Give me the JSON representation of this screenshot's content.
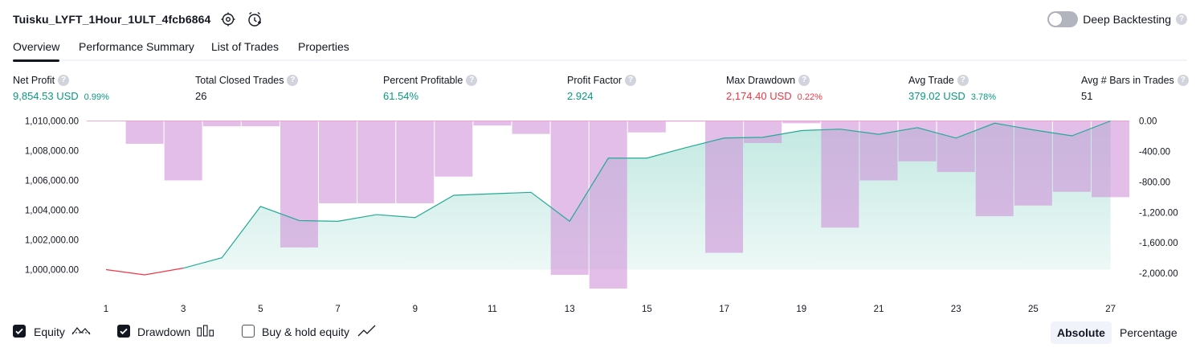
{
  "header": {
    "strategy_title": "Tuisku_LYFT_1Hour_1ULT_4fcb6864",
    "deep_backtesting_label": "Deep Backtesting",
    "help_glyph": "?"
  },
  "tabs": [
    {
      "label": "Overview",
      "active": true
    },
    {
      "label": "Performance Summary",
      "active": false
    },
    {
      "label": "List of Trades",
      "active": false
    },
    {
      "label": "Properties",
      "active": false
    }
  ],
  "metrics": [
    {
      "label": "Net Profit",
      "value": "9,854.53 USD",
      "pct": "0.99%",
      "tone": "green"
    },
    {
      "label": "Total Closed Trades",
      "value": "26",
      "pct": "",
      "tone": "neutral"
    },
    {
      "label": "Percent Profitable",
      "value": "61.54%",
      "pct": "",
      "tone": "green"
    },
    {
      "label": "Profit Factor",
      "value": "2.924",
      "pct": "",
      "tone": "green"
    },
    {
      "label": "Max Drawdown",
      "value": "2,174.40 USD",
      "pct": "0.22%",
      "tone": "red"
    },
    {
      "label": "Avg Trade",
      "value": "379.02 USD",
      "pct": "3.78%",
      "tone": "green"
    },
    {
      "label": "Avg # Bars in Trades",
      "value": "51",
      "pct": "",
      "tone": "neutral"
    }
  ],
  "colors": {
    "equity_line": "#22ab94",
    "equity_fill": "#22ab94",
    "equity_loss_line": "#f23645",
    "drawdown_bar": "#ce93d8",
    "positive": "#089981",
    "negative": "#f23645"
  },
  "chart_data": {
    "type": "area",
    "x": [
      1,
      2,
      3,
      4,
      5,
      6,
      7,
      8,
      9,
      10,
      11,
      12,
      13,
      14,
      15,
      16,
      17,
      18,
      19,
      20,
      21,
      22,
      23,
      24,
      25,
      26,
      27
    ],
    "x_tick_labels": [
      "1",
      "3",
      "5",
      "7",
      "9",
      "11",
      "13",
      "15",
      "17",
      "19",
      "21",
      "23",
      "25",
      "27"
    ],
    "left_axis": {
      "ylim": [
        999000,
        1010000
      ],
      "tick_labels": [
        "1,010,000.00",
        "1,008,000.00",
        "1,006,000.00",
        "1,004,000.00",
        "1,002,000.00",
        "1,000,000.00"
      ]
    },
    "right_axis": {
      "ylim": [
        -2200,
        0
      ],
      "tick_labels": [
        "0.00",
        "-400.00",
        "-800.00",
        "-1,200.00",
        "-1,600.00",
        "-2,000.00"
      ]
    },
    "series": [
      {
        "name": "Equity",
        "axis": "left",
        "values": [
          1000000,
          999650,
          1000100,
          1000800,
          1004250,
          1003300,
          1003250,
          1003700,
          1003500,
          1005000,
          1005100,
          1005200,
          1003250,
          1007500,
          1007500,
          1008200,
          1008850,
          1008900,
          1009350,
          1009450,
          1009100,
          1009550,
          1008850,
          1009850,
          1009400,
          1009000,
          1010000
        ]
      },
      {
        "name": "Drawdown",
        "axis": "right",
        "values": [
          0,
          -300,
          -780,
          -70,
          -70,
          -1660,
          -1080,
          -1080,
          -1080,
          -730,
          -60,
          -170,
          -2020,
          -2200,
          -150,
          0,
          -1730,
          -290,
          -30,
          -1400,
          -780,
          -530,
          -670,
          -1250,
          -1110,
          -930,
          -1000
        ]
      }
    ]
  },
  "legend": [
    {
      "label": "Equity",
      "checked": true,
      "icon": "equity-line-icon"
    },
    {
      "label": "Drawdown",
      "checked": true,
      "icon": "drawdown-bars-icon"
    },
    {
      "label": "Buy & hold equity",
      "checked": false,
      "icon": "buy-hold-line-icon"
    }
  ],
  "view_toggle": {
    "options": [
      "Absolute",
      "Percentage"
    ],
    "selected": "Absolute"
  }
}
